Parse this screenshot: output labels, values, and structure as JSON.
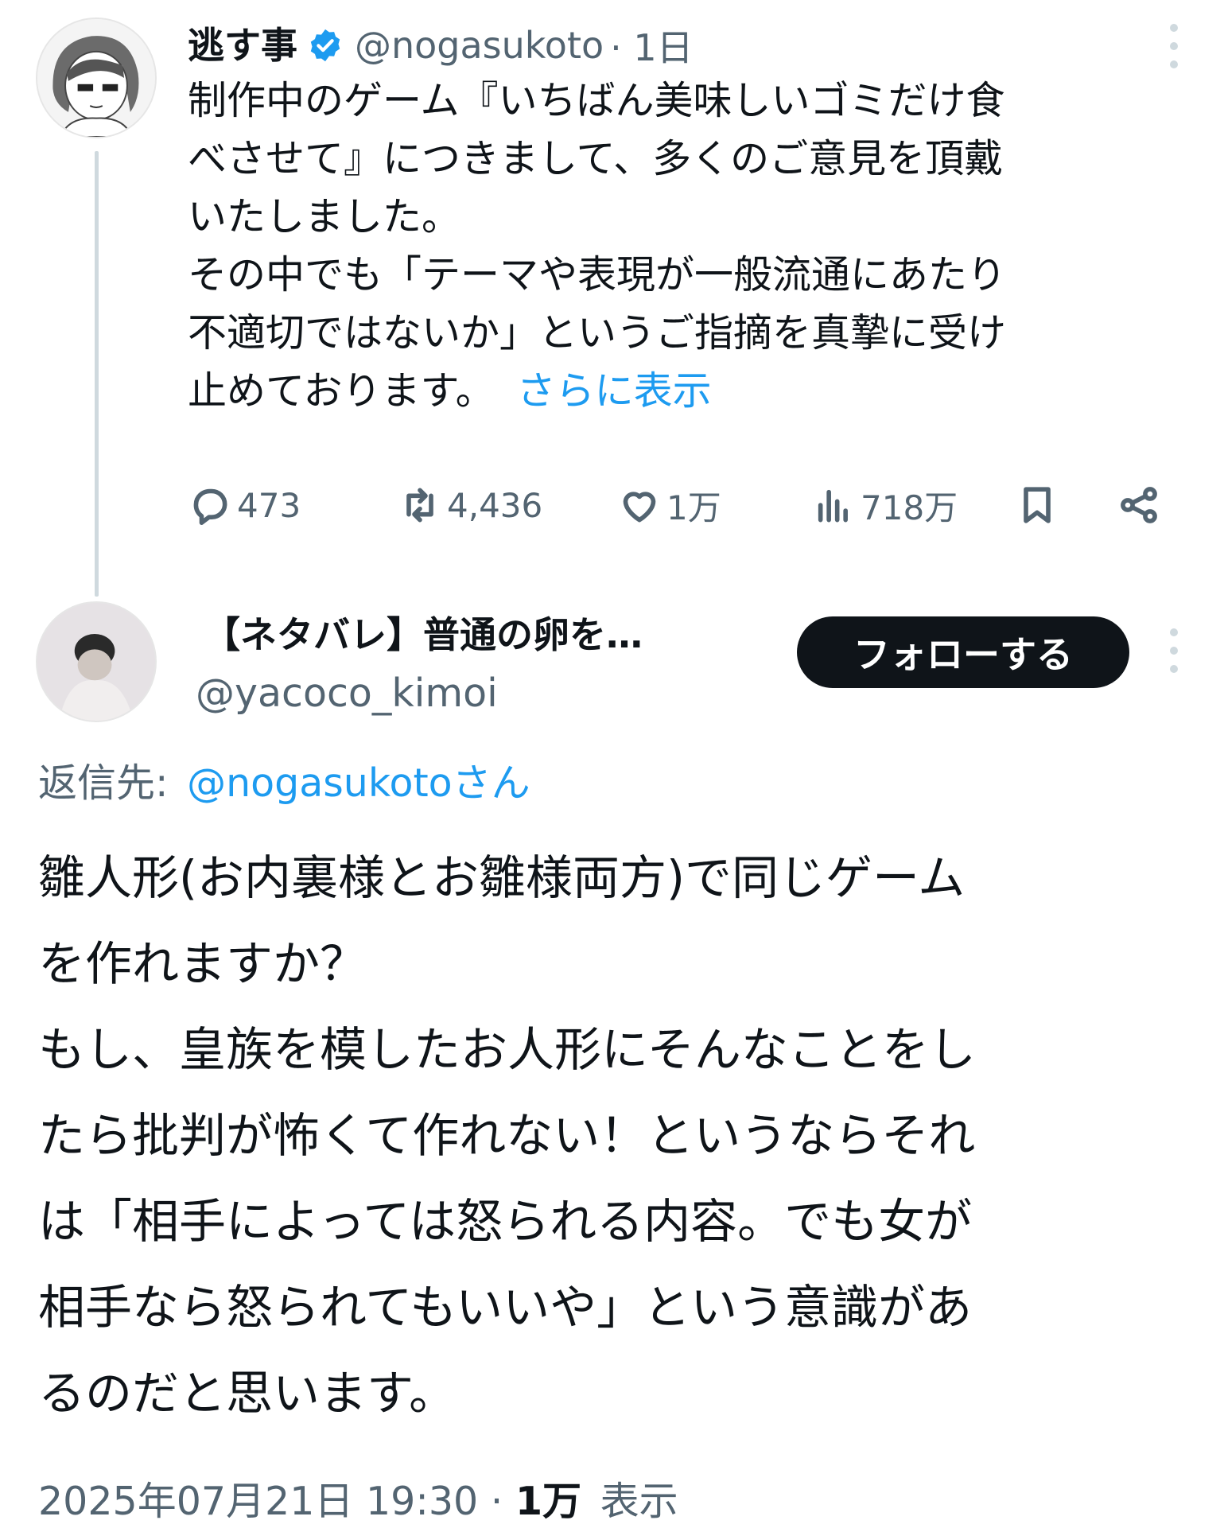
{
  "tweet1": {
    "display_name": "逃す事",
    "handle": "@nogasukoto",
    "time": "· 1日",
    "body_lines": [
      "制作中のゲーム『いちばん美味しいゴミだけ食",
      "べさせて』につきまして、多くのご意見を頂戴",
      "いたしました。",
      "その中でも「テーマや表現が一般流通にあたり",
      "不適切ではないか」というご指摘を真摯に受け",
      "止めております。"
    ],
    "show_more": "さらに表示",
    "actions": {
      "replies": "473",
      "reposts": "4,436",
      "likes": "1万",
      "views": "718万"
    },
    "icons": {
      "reply": "reply-icon",
      "repost": "repost-icon",
      "like": "heart-icon",
      "views": "views-icon",
      "bookmark": "bookmark-icon",
      "share": "share-icon",
      "more": "more-icon",
      "verified": "verified-badge-icon"
    }
  },
  "tweet2": {
    "display_name": "【ネタバレ】普通の卵を…",
    "handle": "@yacoco_kimoi",
    "follow_label": "フォローする",
    "reply_to_prefix": "返信先:",
    "reply_to_handle": "@nogasukotoさん",
    "body_lines": [
      "雛人形(お内裏様とお雛様両方)で同じゲーム",
      "を作れますか？",
      "もし、皇族を模したお人形にそんなことをし",
      "たら批判が怖くて作れない！というならそれ",
      "は「相手によっては怒られる内容。でも女が",
      "相手なら怒られてもいいや」という意識があ",
      "るのだと思います。"
    ],
    "timestamp": "2025年07月21日 19:30",
    "views_count": "1万",
    "views_label": "表示"
  },
  "colors": {
    "text": "#0f1419",
    "secondary": "#536471",
    "link": "#1d9bf0",
    "follow_bg": "#0f1419",
    "thread_line": "#cfd9de"
  }
}
